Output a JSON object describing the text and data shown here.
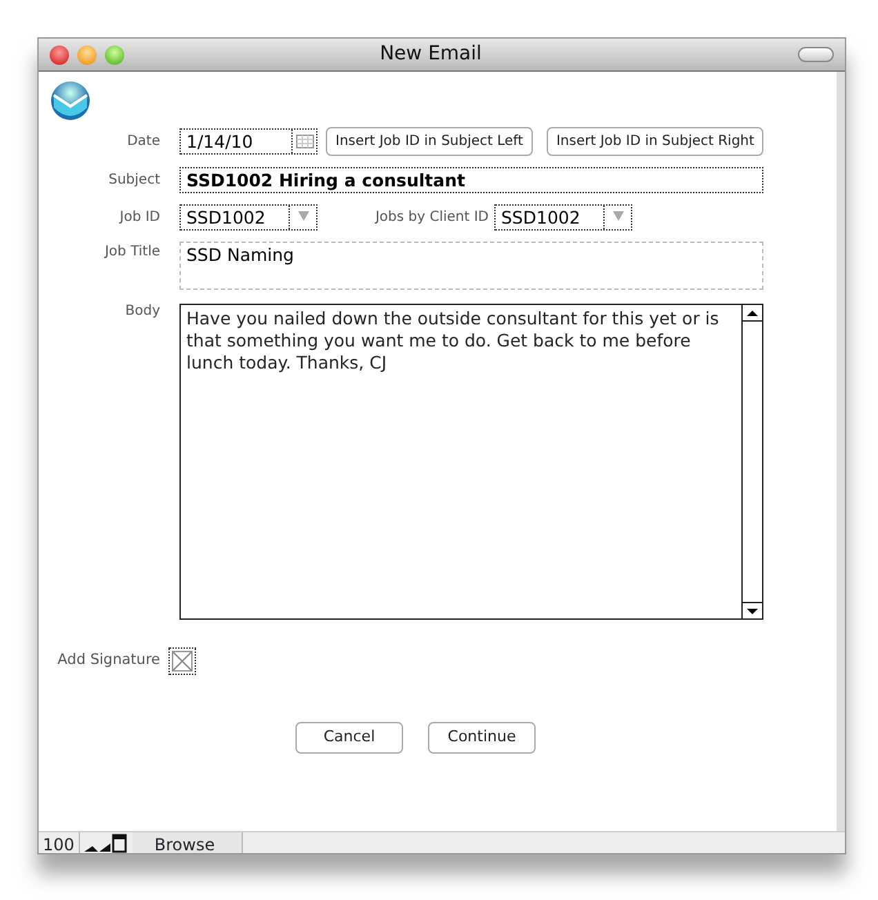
{
  "window": {
    "title": "New Email"
  },
  "fields": {
    "date": {
      "label": "Date",
      "value": "1/14/10"
    },
    "insert_buttons": [
      "Insert Job ID in Subject Left",
      "Insert Job ID in Subject Right"
    ],
    "subject": {
      "label": "Subject",
      "value": "SSD1002 Hiring a consultant"
    },
    "job_id": {
      "label": "Job ID",
      "value": "SSD1002"
    },
    "jobs_by_client": {
      "label": "Jobs by Client ID",
      "value": "SSD1002"
    },
    "job_title": {
      "label": "Job Title",
      "value": "SSD Naming"
    },
    "body": {
      "label": "Body",
      "value": "Have you nailed down the outside consultant for this yet or is that something you want me to do. Get back to me before lunch today. Thanks, CJ"
    },
    "add_signature": {
      "label": "Add Signature",
      "checked": true
    }
  },
  "buttons": [
    "Cancel",
    "Continue"
  ],
  "status_bar": {
    "zoom": "100",
    "mode": "Browse"
  }
}
